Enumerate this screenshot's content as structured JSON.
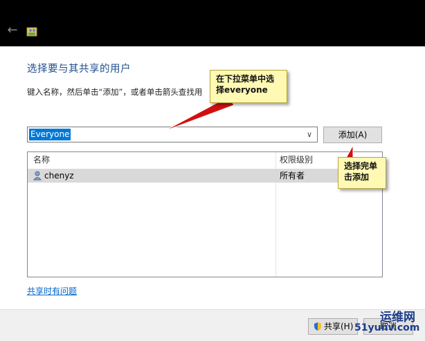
{
  "dialog": {
    "heading": "选择要与其共享的用户",
    "instruction": "键入名称，然后单击“添加”，或者单击箭头查找用"
  },
  "combo": {
    "value": "Everyone"
  },
  "add_button": {
    "label": "添加(A)"
  },
  "list": {
    "columns": [
      "名称",
      "权限级别"
    ],
    "rows": [
      {
        "name": "chenyz",
        "permission": "所有者"
      }
    ]
  },
  "help_link": "共享时有问题",
  "footer": {
    "share_label": "共享(H)",
    "cancel_label": "取消"
  },
  "callouts": [
    {
      "text": "在下拉菜单中选择everyone"
    },
    {
      "text": "选择完单击添加"
    }
  ],
  "watermark": {
    "line1": "运维网",
    "line2": "51yunv.com"
  },
  "colors": {
    "accent": "#0078d7",
    "heading": "#1f4e8c",
    "callout_bg": "#fff9b3",
    "arrow": "#d01010",
    "titlebar": "#000000"
  },
  "icons": [
    "back-arrow-icon",
    "app-icon",
    "chevron-down-icon",
    "user-icon",
    "shield-icon"
  ]
}
